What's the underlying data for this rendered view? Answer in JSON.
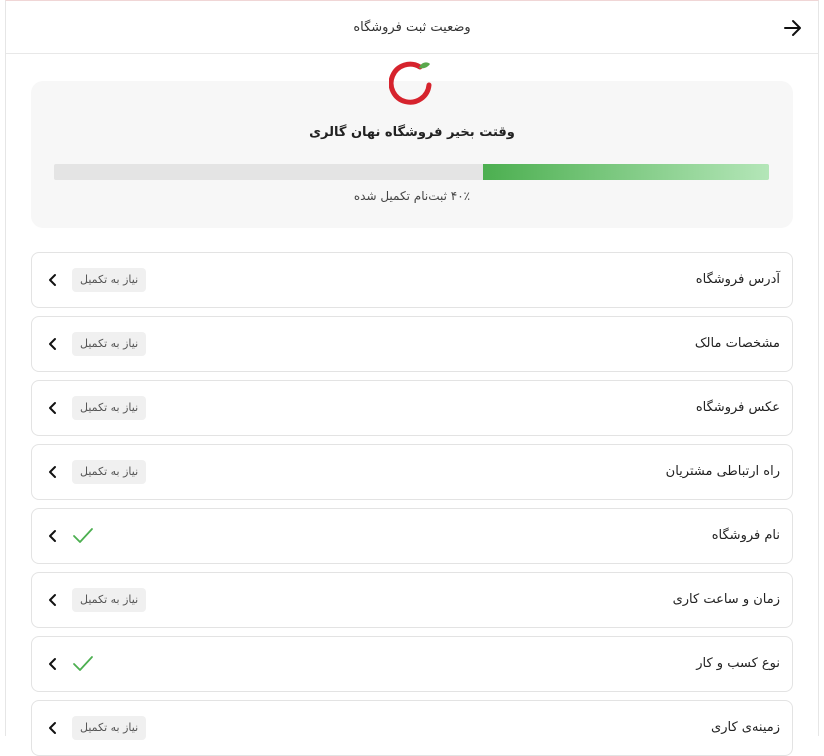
{
  "header": {
    "title": "وضعیت ثبت فروشگاه"
  },
  "status": {
    "greeting": "وقتت بخیر فروشگاه نهان گالری",
    "progress_text": "۴۰٪ ثبت‌نام تکمیل شده",
    "progress_fraction": 0.4,
    "colors": {
      "fill_start": "#4caf50",
      "fill_end": "#b4e6b8",
      "logo": "#d6232d",
      "leaf": "#5aa84c"
    }
  },
  "items": [
    {
      "label": "آدرس فروشگاه",
      "badge": "نیاز به تکمیل",
      "done": false
    },
    {
      "label": "مشخصات مالک",
      "badge": "نیاز به تکمیل",
      "done": false
    },
    {
      "label": "عکس فروشگاه",
      "badge": "نیاز به تکمیل",
      "done": false
    },
    {
      "label": "راه ارتباطی مشتریان",
      "badge": "نیاز به تکمیل",
      "done": false
    },
    {
      "label": "نام فروشگاه",
      "badge": "",
      "done": true
    },
    {
      "label": "زمان و ساعت کاری",
      "badge": "نیاز به تکمیل",
      "done": false
    },
    {
      "label": "نوع کسب و کار",
      "badge": "",
      "done": true
    },
    {
      "label": "زمینه‌ی کاری",
      "badge": "نیاز به تکمیل",
      "done": false
    }
  ],
  "icons": {
    "back": "arrow-right-icon",
    "chevron": "chevron-left-icon",
    "check": "check-icon",
    "logo": "store-logo"
  }
}
